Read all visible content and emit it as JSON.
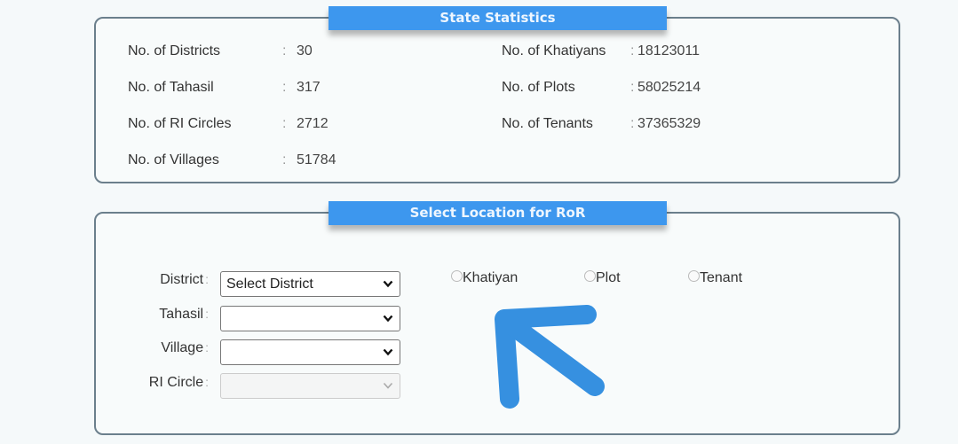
{
  "state_statistics": {
    "title": "State Statistics",
    "left": [
      {
        "label": "No. of Districts",
        "value": "30"
      },
      {
        "label": "No. of Tahasil",
        "value": "317"
      },
      {
        "label": "No. of RI Circles",
        "value": "2712"
      },
      {
        "label": "No. of Villages",
        "value": "51784"
      }
    ],
    "right": [
      {
        "label": "No. of Khatiyans",
        "value": "18123011"
      },
      {
        "label": "No. of Plots",
        "value": "58025214"
      },
      {
        "label": "No. of Tenants",
        "value": "37365329"
      }
    ],
    "separator": ":"
  },
  "ror_location": {
    "title": "Select Location for RoR",
    "fields": [
      {
        "label": "District",
        "value": "Select District",
        "disabled": false
      },
      {
        "label": "Tahasil",
        "value": "",
        "disabled": false
      },
      {
        "label": "Village",
        "value": "",
        "disabled": false
      },
      {
        "label": "RI Circle",
        "value": "",
        "disabled": true
      }
    ],
    "search_by": [
      {
        "label": "Khatiyan",
        "checked": false
      },
      {
        "label": "Plot",
        "checked": false
      },
      {
        "label": "Tenant",
        "checked": false
      }
    ]
  },
  "annotation": {
    "arrow_color": "#3690e0",
    "icon": "arrow-up-left-icon"
  }
}
